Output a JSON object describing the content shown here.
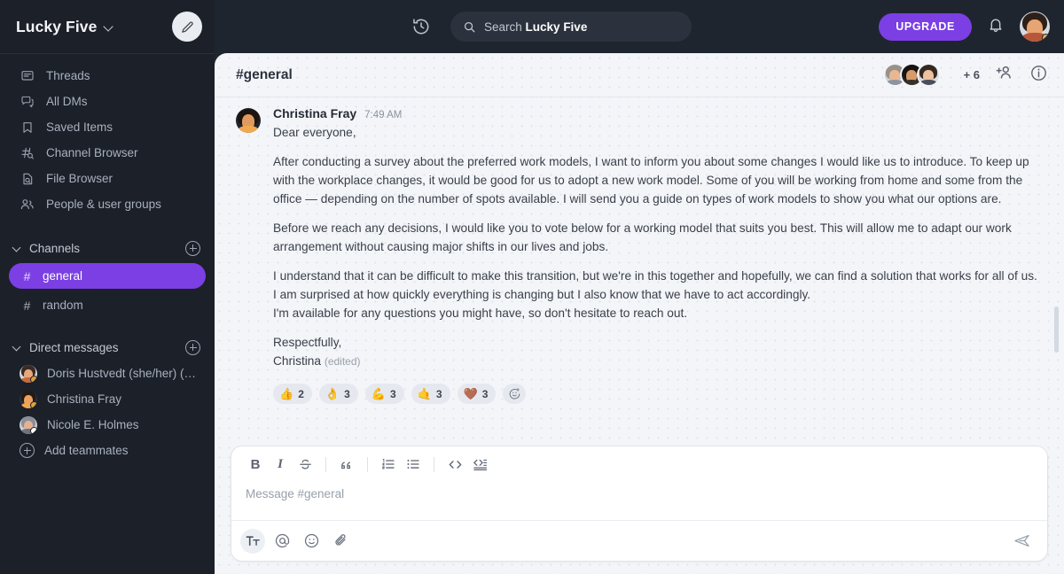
{
  "sidebar": {
    "workspace_name": "Lucky Five",
    "workspace_chevron_icon": "chevron-down-icon",
    "edit_icon": "pencil-icon",
    "nav_items": [
      {
        "label": "Threads",
        "icon": "threads-icon"
      },
      {
        "label": "All DMs",
        "icon": "all-dms-icon"
      },
      {
        "label": "Saved Items",
        "icon": "bookmark-icon"
      },
      {
        "label": "Channel Browser",
        "icon": "channel-search-icon"
      },
      {
        "label": "File Browser",
        "icon": "file-search-icon"
      },
      {
        "label": "People & user groups",
        "icon": "people-icon"
      }
    ],
    "channels_section": {
      "label": "Channels",
      "add_icon": "plus-circle-icon",
      "items": [
        {
          "label": "general",
          "prefix": "#",
          "active": true
        },
        {
          "label": "random",
          "prefix": "#",
          "active": false
        }
      ]
    },
    "dms_section": {
      "label": "Direct messages",
      "add_icon": "plus-circle-icon",
      "items": [
        {
          "label": "Doris Hustvedt (she/her) (…",
          "status": "away"
        },
        {
          "label": "Christina Fray",
          "status": "away"
        },
        {
          "label": "Nicole E. Holmes",
          "status": "active"
        }
      ],
      "add_teammates_label": "Add teammates",
      "add_teammates_icon": "plus-circle-icon"
    }
  },
  "topbar": {
    "history_icon": "history-clock-icon",
    "search": {
      "icon": "search-icon",
      "prefix": "Search",
      "scope": "Lucky Five",
      "placeholder": "Search Lucky Five"
    },
    "upgrade_label": "UPGRADE",
    "notifications_icon": "bell-icon",
    "avatar_icon": "user-avatar"
  },
  "channel_header": {
    "title": "#general",
    "member_overflow": "+ 6",
    "add_people_icon": "add-person-icon",
    "info_icon": "info-circle-icon"
  },
  "message": {
    "author": "Christina Fray",
    "time": "7:49 AM",
    "greeting": "Dear everyone,",
    "paragraphs": [
      "After conducting a survey about the preferred work models, I want to inform you about some changes I would like us to introduce. To keep up with the workplace changes, it would be good for us to adopt a new work model. Some of you will be working from home and some from the office — depending on the number of spots available. I will send you a guide on types of work models to show you what our options are.",
      "Before we reach any decisions, I would like you to vote below for a working model that suits you best. This will allow me to adapt our work arrangement without causing major shifts in our lives and jobs.",
      "I understand that it can be difficult to make this transition, but we're in this together and hopefully, we can find a solution that works for all of us. I am surprised at how quickly everything is changing but I also know that we have to act accordingly.",
      "I'm available for any questions you might have, so don't hesitate to reach out."
    ],
    "sign_off": "Respectfully,",
    "signature": "Christina",
    "edited_label": "(edited)",
    "reactions": [
      {
        "emoji": "👍",
        "count": "2",
        "name": "thumbs-up"
      },
      {
        "emoji": "👌",
        "count": "3",
        "name": "ok-hand"
      },
      {
        "emoji": "💪",
        "count": "3",
        "name": "flexed-biceps"
      },
      {
        "emoji": "🤙",
        "count": "3",
        "name": "call-me-hand"
      },
      {
        "emoji": "🤎",
        "count": "3",
        "name": "brown-heart"
      }
    ],
    "add_reaction_icon": "add-reaction-icon"
  },
  "composer": {
    "format_buttons": [
      {
        "label": "B",
        "name": "bold-button"
      },
      {
        "label": "I",
        "name": "italic-button"
      },
      {
        "label": "S",
        "name": "strikethrough-button"
      },
      {
        "label": "❝",
        "name": "blockquote-button"
      },
      {
        "label": "",
        "name": "ordered-list-button"
      },
      {
        "label": "",
        "name": "bullet-list-button"
      },
      {
        "label": "< >",
        "name": "code-button"
      },
      {
        "label": "",
        "name": "code-block-button"
      }
    ],
    "placeholder": "Message #general",
    "value": "",
    "bottom_icons": [
      {
        "name": "text-format-icon",
        "label": "Tt"
      },
      {
        "name": "mention-icon",
        "label": "@"
      },
      {
        "name": "emoji-icon",
        "label": "☺"
      },
      {
        "name": "attachment-icon",
        "label": "📎"
      }
    ],
    "send_icon": "send-icon"
  },
  "colors": {
    "accent": "#7b3fe4",
    "sidebar_bg": "#1b2029",
    "topbar_bg": "#1f252e",
    "content_bg": "#f3f5f8"
  }
}
